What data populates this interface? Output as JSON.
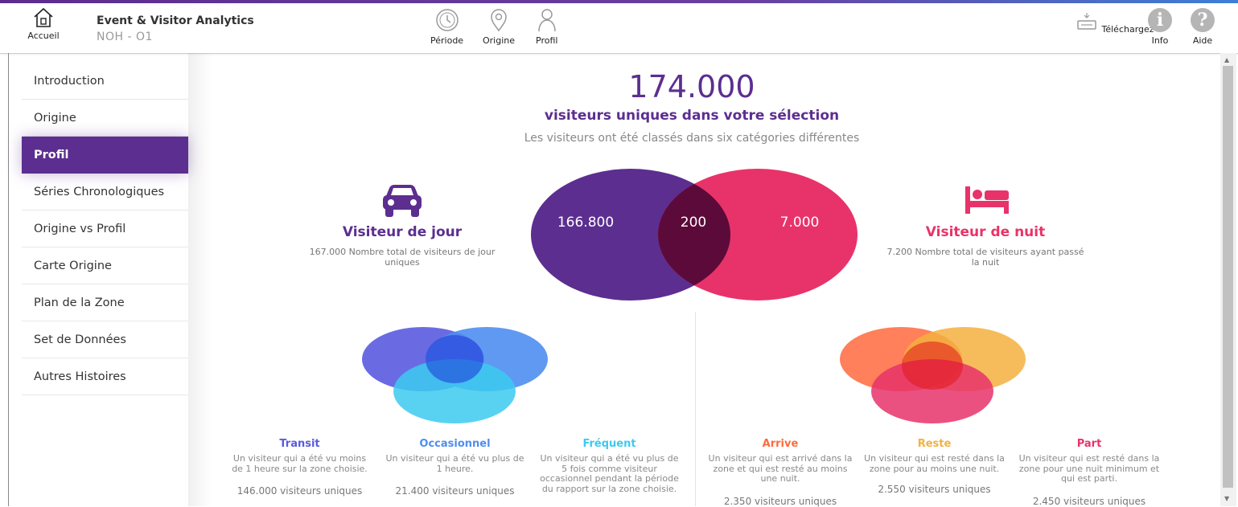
{
  "colors": {
    "accent": "#5c2e90",
    "night": "#e8336a",
    "transit": "#5a5be0",
    "occasionnel": "#4f8ef0",
    "frequent": "#3ccaf0",
    "arrive": "#ff6a3d",
    "reste": "#f5b040",
    "part": "#e8336a"
  },
  "header": {
    "home_label": "Accueil",
    "title": "Event & Visitor Analytics",
    "subtitle": "NOH - O1",
    "nav": [
      {
        "label": "Période",
        "icon": "clock-icon"
      },
      {
        "label": "Origine",
        "icon": "location-pin-icon"
      },
      {
        "label": "Profil",
        "icon": "person-icon"
      }
    ],
    "actions": [
      {
        "label": "Téléchargez",
        "icon": "download-icon"
      },
      {
        "label": "Info",
        "icon": "info-icon",
        "glyph": "i"
      },
      {
        "label": "Aide",
        "icon": "help-icon",
        "glyph": "?"
      }
    ]
  },
  "sidebar": {
    "items": [
      {
        "label": "Introduction"
      },
      {
        "label": "Origine"
      },
      {
        "label": "Profil",
        "active": true
      },
      {
        "label": "Séries Chronologiques"
      },
      {
        "label": "Origine vs Profil"
      },
      {
        "label": "Carte Origine"
      },
      {
        "label": "Plan de la Zone"
      },
      {
        "label": "Set de Données"
      },
      {
        "label": "Autres Histoires"
      }
    ]
  },
  "main": {
    "total": "174.000",
    "total_label": "visiteurs uniques dans votre sélection",
    "caption": "Les visiteurs ont été classés dans six catégories différentes",
    "day": {
      "title": "Visiteur de jour",
      "desc": "167.000 Nombre total de visiteurs de jour uniques",
      "icon": "car-icon"
    },
    "night": {
      "title": "Visiteur de nuit",
      "desc": "7.200 Nombre total de visiteurs ayant passé la nuit",
      "icon": "bed-icon"
    },
    "venn": {
      "day_only": "166.800",
      "both": "200",
      "night_only": "7.000"
    },
    "day_categories": [
      {
        "title": "Transit",
        "desc": "Un visiteur qui a été vu moins de 1 heure sur la zone choisie.",
        "count": "146.000 visiteurs uniques"
      },
      {
        "title": "Occasionnel",
        "desc": "Un visiteur qui a été vu plus de 1 heure.",
        "count": "21.400 visiteurs uniques"
      },
      {
        "title": "Fréquent",
        "desc": "Un visiteur qui a été vu plus de 5 fois comme visiteur occasionnel pendant la période du rapport sur la zone choisie.",
        "count": ""
      }
    ],
    "night_categories": [
      {
        "title": "Arrive",
        "desc": "Un visiteur qui est arrivé dans la zone et qui est resté au moins une nuit.",
        "count": "2.350 visiteurs uniques"
      },
      {
        "title": "Reste",
        "desc": "Un visiteur qui est resté dans la zone pour au moins une nuit.",
        "count": "2.550 visiteurs uniques"
      },
      {
        "title": "Part",
        "desc": "Un visiteur qui est resté dans la zone pour une nuit minimum et qui est parti.",
        "count": "2.450 visiteurs uniques"
      }
    ]
  }
}
